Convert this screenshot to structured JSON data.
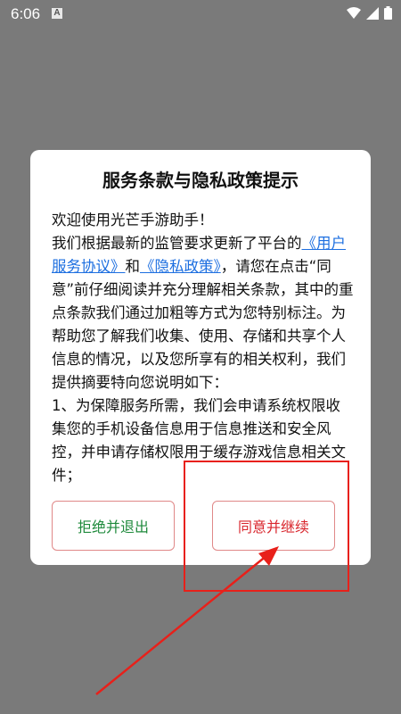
{
  "status_bar": {
    "time": "6:06",
    "app_icon": "A"
  },
  "dialog": {
    "title": "服务条款与隐私政策提示",
    "greeting": "欢迎使用光芒手游助手！",
    "p1_before": "我们根据最新的监管要求更新了平台的",
    "link_service": "《用户服务协议》",
    "p1_and": "和",
    "link_privacy": "《隐私政策》",
    "p1_after": "，请您在点击“同意”前仔细阅读并充分理解相关条款，其中的重点条款我们通过加粗等方式为您特别标注。为帮助您了解我们收集、使用、存储和共享个人信息的情况，以及您所享有的相关权利，我们提供摘要特向您说明如下：",
    "item1": "1、为保障服务所需，我们会申请系统权限收集您的手机设备信息用于信息推送和安全风控，并申请存储权限用于缓存游戏信息相关文件；",
    "reject_label": "拒绝并退出",
    "agree_label": "同意并继续"
  },
  "colors": {
    "backdrop": "#7a7a7a",
    "link": "#1d6fe0",
    "reject_text": "#1f8a3c",
    "agree_text": "#d9272e",
    "annotation": "#e8201a"
  }
}
